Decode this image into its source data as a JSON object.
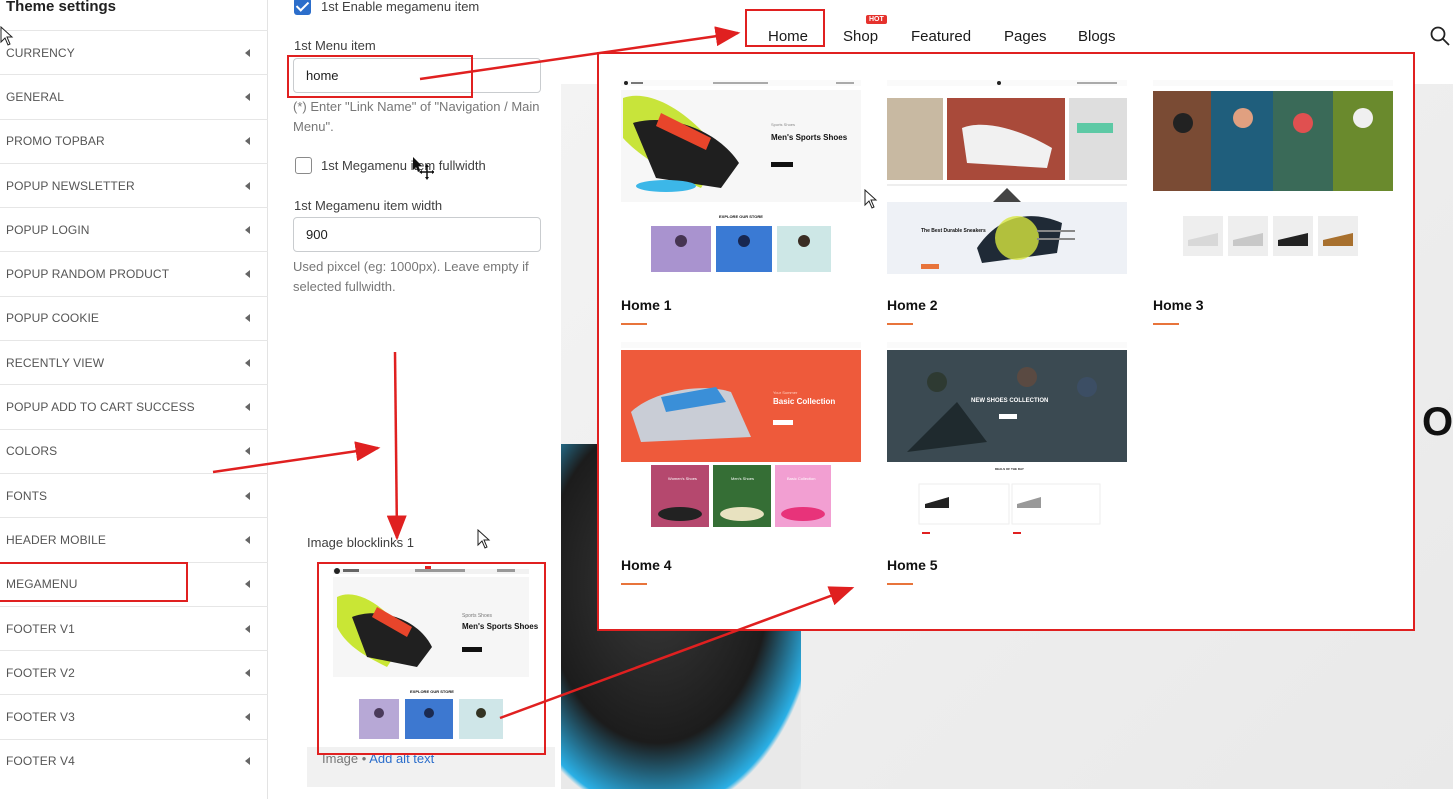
{
  "sidebar": {
    "title": "Theme settings",
    "items": [
      {
        "label": "CURRENCY"
      },
      {
        "label": "GENERAL"
      },
      {
        "label": "PROMO TOPBAR"
      },
      {
        "label": "POPUP NEWSLETTER"
      },
      {
        "label": "POPUP LOGIN"
      },
      {
        "label": "POPUP RANDOM PRODUCT"
      },
      {
        "label": "POPUP COOKIE"
      },
      {
        "label": "RECENTLY VIEW"
      },
      {
        "label": "POPUP ADD TO CART SUCCESS"
      },
      {
        "label": "COLORS"
      },
      {
        "label": "FONTS"
      },
      {
        "label": "HEADER MOBILE"
      },
      {
        "label": "MEGAMENU"
      },
      {
        "label": "FOOTER V1"
      },
      {
        "label": "FOOTER V2"
      },
      {
        "label": "FOOTER V3"
      },
      {
        "label": "FOOTER V4"
      }
    ]
  },
  "settings": {
    "enable_label": "1st Enable megamenu item",
    "enable_checked": true,
    "menu_item_label": "1st Menu item",
    "menu_item_value": "home",
    "menu_item_help": "(*) Enter \"Link Name\" of \"Navigation / Main Menu\".",
    "fullwidth_label": "1st Megamenu item fullwidth",
    "fullwidth_checked": false,
    "width_label": "1st Megamenu item width",
    "width_value": "900",
    "width_help": "Used pixcel (eg: 1000px). Leave empty if selected fullwidth.",
    "blocklinks_label": "Image blocklinks 1",
    "image_label": "Image",
    "alt_text_link": "Add alt text"
  },
  "nav": {
    "items": [
      "Home",
      "Shop",
      "Featured",
      "Pages",
      "Blogs"
    ],
    "hot_badge": "HOT"
  },
  "megamenu": {
    "items": [
      {
        "title": "Home 1"
      },
      {
        "title": "Home 2"
      },
      {
        "title": "Home 3"
      },
      {
        "title": "Home 4"
      },
      {
        "title": "Home 5"
      }
    ]
  },
  "thumb_text": {
    "home1_headline": "Men's Sports Shoes",
    "home1_section": "EXPLORE OUR STORE",
    "home2_banner": "The Best Durable Sneakers",
    "home4_banner": "Basic Collection",
    "home4_cards": [
      "Women's Shoes",
      "Men's Shoes",
      "Basic Collection"
    ],
    "home5_banner": "NEW SHOES COLLECTION",
    "home5_section": "DEALS OF THE DAY"
  },
  "colors": {
    "accent": "#e02020",
    "checkbox": "#2c6ecb",
    "link": "#2c6ecb",
    "underline": "#e8743b"
  }
}
